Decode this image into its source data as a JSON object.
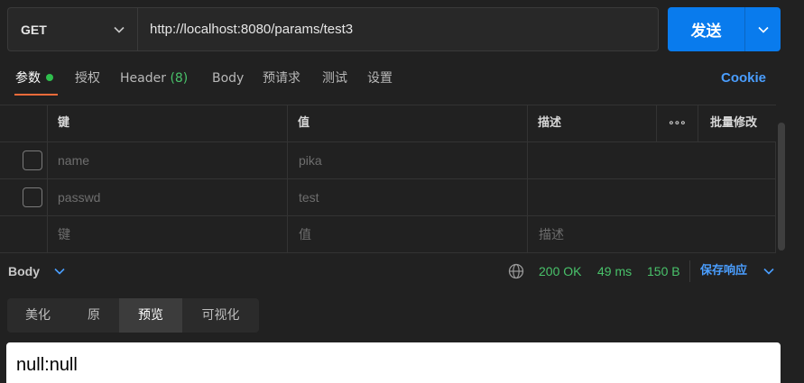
{
  "request": {
    "method": "GET",
    "url": "http://localhost:8080/params/test3",
    "send_label": "发送"
  },
  "tabs": {
    "params": "参数",
    "auth": "授权",
    "header": "Header",
    "header_count": "(8)",
    "body": "Body",
    "prerequest": "预请求",
    "tests": "测试",
    "settings": "设置",
    "cookie": "Cookie"
  },
  "params_table": {
    "headers": {
      "key": "键",
      "value": "值",
      "description": "描述",
      "more": "∘∘∘",
      "bulk_edit": "批量修改"
    },
    "rows": [
      {
        "key": "name",
        "value": "pika",
        "description": ""
      },
      {
        "key": "passwd",
        "value": "test",
        "description": ""
      }
    ],
    "placeholder": {
      "key": "键",
      "value": "值",
      "description": "描述"
    }
  },
  "response": {
    "body_label": "Body",
    "status": "200 OK",
    "time": "49 ms",
    "size": "150 B",
    "save_label": "保存响应",
    "view_tabs": [
      "美化",
      "原",
      "预览",
      "可视化"
    ],
    "active_view": "预览",
    "preview_text": "null:null"
  },
  "colors": {
    "accent": "#097bed",
    "tab_indicator": "#f26b3a",
    "success": "#49c26a",
    "link": "#4a9eff"
  }
}
